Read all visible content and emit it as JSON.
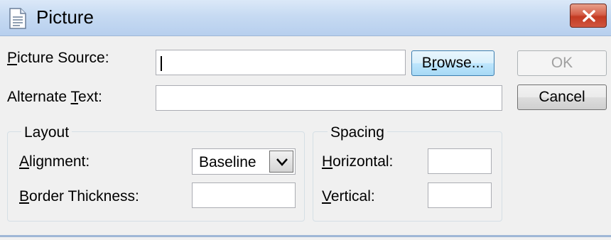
{
  "window": {
    "title": "Picture",
    "icon": "document-icon",
    "close_icon": "close-icon"
  },
  "form": {
    "picture_source": {
      "label_first": "P",
      "label_rest": "icture Source:",
      "value": ""
    },
    "alternate_text": {
      "label_first": "Alternate ",
      "label_mnemonic": "T",
      "label_rest": "ext:",
      "value": ""
    }
  },
  "buttons": {
    "browse": {
      "first": "B",
      "mnemonic": "r",
      "rest": "owse..."
    },
    "ok": "OK",
    "cancel": "Cancel"
  },
  "layout_group": {
    "legend": "Layout",
    "alignment": {
      "label_mnemonic": "A",
      "label_rest": "lignment:",
      "value": "Baseline"
    },
    "border_thickness": {
      "label_mnemonic": "B",
      "label_rest": "order Thickness:",
      "value": ""
    }
  },
  "spacing_group": {
    "legend": "Spacing",
    "horizontal": {
      "label_mnemonic": "H",
      "label_rest": "orizontal:",
      "value": ""
    },
    "vertical": {
      "label_mnemonic": "V",
      "label_rest": "ertical:",
      "value": ""
    }
  }
}
